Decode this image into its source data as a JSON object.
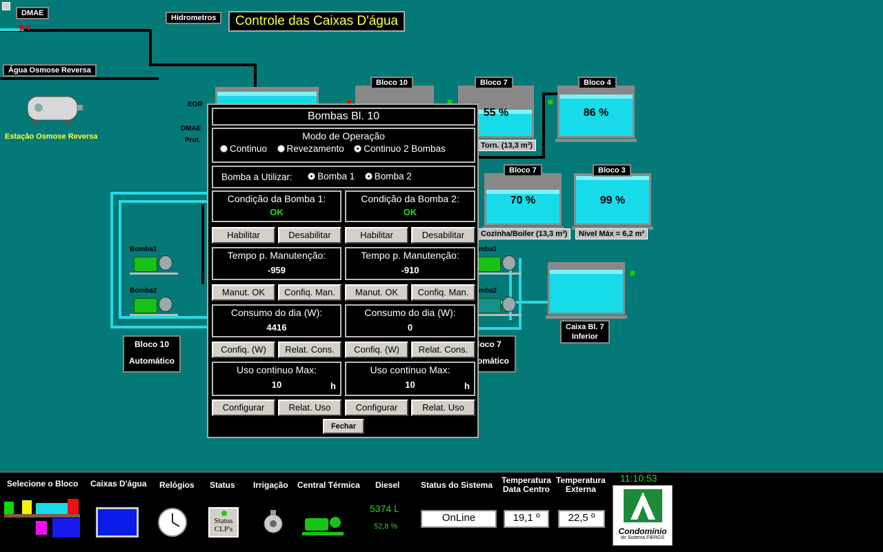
{
  "header": {
    "dmae": "DMAE",
    "hidrometros": "Hidrometros",
    "title": "Controle das Caixas D'água",
    "agua_osmose": "Água Osmose Reversa",
    "estacao_osmose": "Estação Osmose Reversa",
    "eor": "EOR",
    "dmae_side": "DMAE",
    "prot": "Prot."
  },
  "tanks": {
    "bloco10_label": "Bloco 10",
    "bloco7a_label": "Bloco 7",
    "bloco7a_pct": "55 %",
    "bloco7a_caption": "Torn.  (13,3 m³)",
    "bloco4_label": "Bloco 4",
    "bloco4_pct": "86 %",
    "bloco7b_label": "Bloco 7",
    "bloco7b_pct": "70 %",
    "bloco7b_caption": "Cozinha/Boiler  (13,3 m³)",
    "bloco3_label": "Bloco 3",
    "bloco3_pct": "99 %",
    "bloco3_caption": "Nivel Máx = 6,2 m³",
    "inferior_caption_1": "Caixa Bl. 7",
    "inferior_caption_2": "Inferior",
    "levels": {
      "bloco7a": 0.55,
      "bloco4": 0.86,
      "bloco7b": 0.7,
      "bloco3": 0.99,
      "inferior": 0.88
    }
  },
  "pumps": {
    "bomba1": "Bomba1",
    "bomba2": "Bomba2",
    "right_bomba1": "mba1",
    "right_bomba2": "mba2"
  },
  "modes": {
    "left_title": "Bloco 10",
    "left_value": "Automático",
    "right_title": "loco 7",
    "right_value": "omático"
  },
  "dialog": {
    "title": "Bombas Bl. 10",
    "modo_title": "Modo de Operação",
    "modo_options": [
      "Continuo",
      "Revezamento",
      "Continuo 2 Bombas"
    ],
    "modo_selected": 2,
    "bomba_utilizar": "Bomba a Utilizar:",
    "bomba_options": [
      "Bomba 1",
      "Bomba 2"
    ],
    "cond1_title": "Condição da Bomba 1:",
    "cond1_value": "OK",
    "cond2_title": "Condição da Bomba 2:",
    "cond2_value": "OK",
    "habilitar": "Habilitar",
    "desabilitar": "Desabilitar",
    "tempo_title": "Tempo p. Manutenção:",
    "tempo1_value": "-959",
    "tempo2_value": "-910",
    "manut_ok": "Manut. OK",
    "config_man": "Confiq. Man.",
    "consumo_title": "Consumo do dia (W):",
    "consumo1_value": "4416",
    "consumo2_value": "0",
    "config_w": "Confiq. (W)",
    "relat_cons": "Relat. Cons.",
    "uso_title": "Uso continuo Max:",
    "uso1_value": "10",
    "uso2_value": "10",
    "uso_unit": "h",
    "configurar": "Configurar",
    "relat_uso": "Relat. Uso",
    "fechar": "Fechar"
  },
  "bottom": {
    "selecione": "Selecione o Bloco",
    "caixas": "Caixas D'água",
    "relogios": "Relógios",
    "status": "Status",
    "status_clp": "Status CLP's",
    "irrigacao": "Irrigação",
    "central": "Central Térmica",
    "diesel": "Diesel",
    "diesel_l": "5374 L",
    "diesel_pct": "52,8 %",
    "status_sistema": "Status do Sistema",
    "status_value": "OnLine",
    "temp_dc_1": "Temperatura",
    "temp_dc_2": "Data Centro",
    "temp_dc_value": "19,1 º",
    "temp_ext_1": "Temperatura",
    "temp_ext_2": "Externa",
    "temp_ext_value": "22,5 º",
    "clock": "11:10:53",
    "logo_text_1": "Condomínio",
    "logo_text_2": "do Sistema FIERGS"
  }
}
